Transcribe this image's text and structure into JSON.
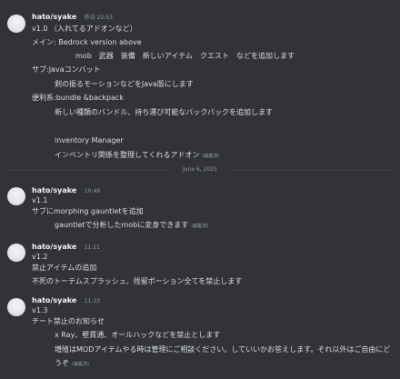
{
  "messages": [
    {
      "username": "hato/syake",
      "timestamp": "昨日 22:53",
      "lines": [
        "v1.0 （入れてるアドオンなど）",
        "メイン: Bedrock version above",
        "mob　武器　装備　新しいアイテム　クエスト　などを追加します",
        "サブ:Javaコンバット",
        "剣の振るモーションなどをJava版にします",
        "便利系:bundle &backpack",
        "新しい種類のバンドル、持ち運び可能なバックバックを追加します",
        "inventory Manager",
        "インベントリ関係を整理してくれるアドオン"
      ],
      "edited": "(編集済)"
    },
    {
      "username": "hato/syake",
      "timestamp": "10:49",
      "lines": [
        "v1.1",
        "サブにmorphing gauntletを追加",
        "gauntletで分析したmobに変身できます"
      ],
      "edited": "(編集済)"
    },
    {
      "username": "hato/syake",
      "timestamp": "11:21",
      "lines": [
        "v1.2",
        "禁止アイテムの追加",
        "不死のトーテムスプラッシュ、残留ポーション全てを禁止します"
      ]
    },
    {
      "username": "hato/syake",
      "timestamp": "11:33",
      "lines": [
        "v1.3",
        "チート禁止のお知らせ",
        "x Ray、壁貫通、オールハックなどを禁止とします",
        "増殖はMODアイテムやる時は管理にご相談ください。していいかお答えします。それ以外はご自由にど",
        "うぞ"
      ],
      "edited": "(編集済)"
    }
  ],
  "date_divider": "June 6, 2025"
}
